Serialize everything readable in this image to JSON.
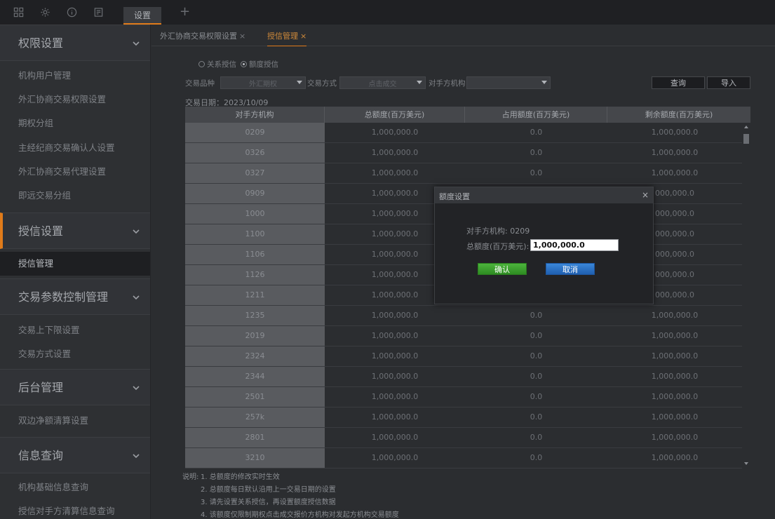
{
  "topbar": {
    "icons": [
      "grid-icon",
      "gear-icon",
      "info-icon",
      "document-icon"
    ],
    "active_tab": "设置",
    "plus": "+"
  },
  "sidebar": {
    "groups": [
      {
        "label": "权限设置",
        "items": [
          "机构用户管理",
          "外汇协商交易权限设置",
          "期权分组",
          "主经纪商交易确认人设置",
          "外汇协商交易代理设置",
          "即远交易分组"
        ]
      },
      {
        "label": "授信设置",
        "items": [
          "授信管理"
        ]
      },
      {
        "label": "交易参数控制管理",
        "items": [
          "交易上下限设置",
          "交易方式设置"
        ]
      },
      {
        "label": "后台管理",
        "items": [
          "双边净额清算设置"
        ]
      },
      {
        "label": "信息查询",
        "items": [
          "机构基础信息查询",
          "授信对手方清算信息查询"
        ]
      }
    ],
    "active_item": "授信管理"
  },
  "tabs": [
    {
      "label": "外汇协商交易权限设置",
      "close": "×"
    },
    {
      "label": "授信管理",
      "close": "×"
    }
  ],
  "radios": [
    {
      "label": "关系授信",
      "checked": false
    },
    {
      "label": "额度授信",
      "checked": true
    }
  ],
  "filters": {
    "product_label": "交易品种",
    "product_value": "外汇期权",
    "method_label": "交易方式",
    "method_value": "点击成交",
    "counterparty_label": "对手方机构",
    "counterparty_value": ""
  },
  "buttons": {
    "query": "查询",
    "import": "导入"
  },
  "trade_date": "交易日期：2023/10/09",
  "table": {
    "headers": [
      "对手方机构",
      "总额度(百万美元)",
      "占用额度(百万美元)",
      "剩余额度(百万美元)"
    ],
    "rows": [
      [
        "0209",
        "1,000,000.0",
        "0.0",
        "1,000,000.0"
      ],
      [
        "0326",
        "1,000,000.0",
        "0.0",
        "1,000,000.0"
      ],
      [
        "0327",
        "1,000,000.0",
        "0.0",
        "1,000,000.0"
      ],
      [
        "0909",
        "1,000,000.0",
        "",
        "000,000.0"
      ],
      [
        "1000",
        "1,000,000.0",
        "",
        "000,000.0"
      ],
      [
        "1100",
        "1,000,000.0",
        "",
        "000,000.0"
      ],
      [
        "1106",
        "1,000,000.0",
        "",
        "000,000.0"
      ],
      [
        "1126",
        "1,000,000.0",
        "",
        "000,000.0"
      ],
      [
        "1211",
        "1,000,000.0",
        "",
        "000,000.0"
      ],
      [
        "1235",
        "1,000,000.0",
        "0.0",
        "1,000,000.0"
      ],
      [
        "2019",
        "1,000,000.0",
        "0.0",
        "1,000,000.0"
      ],
      [
        "2324",
        "1,000,000.0",
        "0.0",
        "1,000,000.0"
      ],
      [
        "2344",
        "1,000,000.0",
        "0.0",
        "1,000,000.0"
      ],
      [
        "2501",
        "1,000,000.0",
        "0.0",
        "1,000,000.0"
      ],
      [
        "257k",
        "1,000,000.0",
        "0.0",
        "1,000,000.0"
      ],
      [
        "2801",
        "1,000,000.0",
        "0.0",
        "1,000,000.0"
      ],
      [
        "3210",
        "1,000,000.0",
        "0.0",
        "1,000,000.0"
      ]
    ]
  },
  "notes": {
    "title": "说明:",
    "items": [
      "1. 总额度的修改实时生效",
      "2. 总额度每日默认沿用上一交易日期的设置",
      "3. 请先设置关系授信，再设置额度授信数据",
      "4. 该额度仅限制期权点击成交报价方机构对发起方机构交易额度"
    ]
  },
  "modal": {
    "title": "额度设置",
    "close": "×",
    "counterparty": "对手方机构:  0209",
    "total_label": "总额度(百万美元):",
    "total_value": "1,000,000.0",
    "ok": "确认",
    "cancel": "取消"
  }
}
